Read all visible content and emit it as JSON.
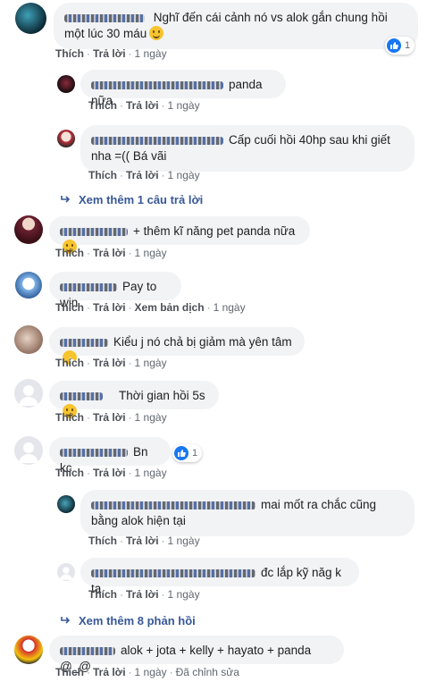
{
  "actions": {
    "like": "Thích",
    "reply": "Trả lời",
    "translate": "Xem bản dịch",
    "edited": "Đã chỉnh sửa"
  },
  "comments": [
    {
      "text": "Nghĩ đến cái cảnh nó vs alok gắn chung hồi một lúc 30 máu",
      "time": "1 ngày",
      "reactions": "1"
    },
    {
      "text": "panda nữa",
      "time": "1 ngày"
    },
    {
      "text": "Cấp cuối hồi 40hp sau khi giết nha =(( Bá vãi",
      "time": "1 ngày"
    },
    {
      "text": "+ thêm kĩ năng pet panda nữa",
      "time": "1 ngày"
    },
    {
      "text": "Pay to win",
      "time": "1 ngày"
    },
    {
      "text": "Kiểu j nó chả bị giảm mà yên tâm",
      "time": "1 ngày"
    },
    {
      "text": "Thời gian hồi 5s",
      "time": "1 ngày"
    },
    {
      "text": "Bn kc",
      "time": "1 ngày",
      "reactions": "1"
    },
    {
      "text": "mai mốt ra chắc cũng bằng alok hiện tại",
      "time": "1 ngày"
    },
    {
      "text": "đc lắp kỹ năg k ta",
      "time": "1 ngày"
    },
    {
      "text": "alok + jota + kelly + hayato + panda @_@",
      "time": "1 ngày"
    }
  ],
  "see_more": {
    "replies_1": "Xem thêm 1 câu trả lời",
    "replies_8": "Xem thêm 8 phản hồi"
  },
  "colors": {
    "link": "#385898",
    "bubble": "#f2f3f5",
    "like_blue": "#1877f2"
  }
}
